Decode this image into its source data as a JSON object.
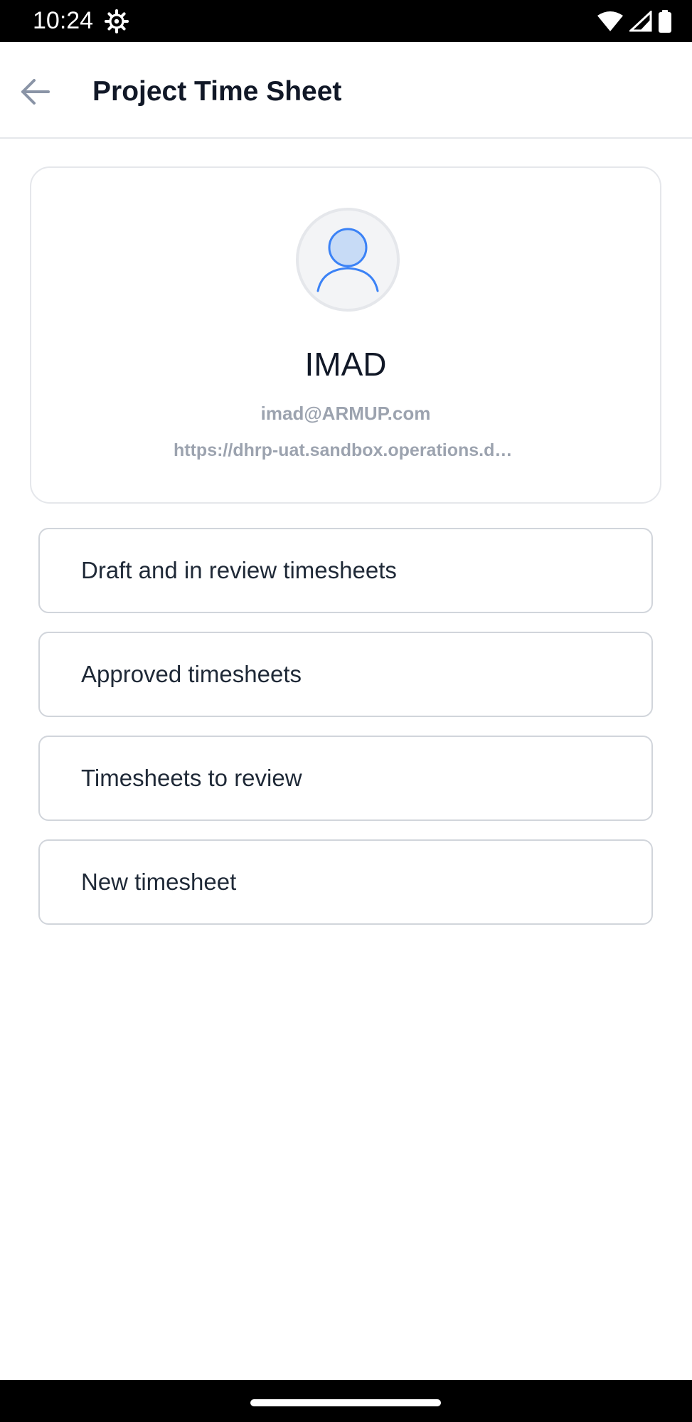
{
  "status_bar": {
    "time": "10:24",
    "icons": [
      "gear-icon",
      "wifi-icon",
      "signal-icon",
      "battery-icon"
    ]
  },
  "app_bar": {
    "back_icon": "arrow-left-icon",
    "title": "Project Time Sheet"
  },
  "profile": {
    "avatar_icon": "user-icon",
    "name": "IMAD",
    "email": "imad@ARMUP.com",
    "url": "https://dhrp-uat.sandbox.operations.dynamics.com"
  },
  "menu": {
    "items": [
      {
        "label": "Draft and in review timesheets"
      },
      {
        "label": "Approved timesheets"
      },
      {
        "label": "Timesheets to review"
      },
      {
        "label": "New timesheet"
      }
    ]
  },
  "colors": {
    "title_text": "#111827",
    "muted_text": "#9ca3af",
    "border": "#d1d5db",
    "avatar_fill": "#c7dbf6",
    "avatar_stroke": "#3b82f6",
    "back_arrow": "#8a94a6"
  }
}
